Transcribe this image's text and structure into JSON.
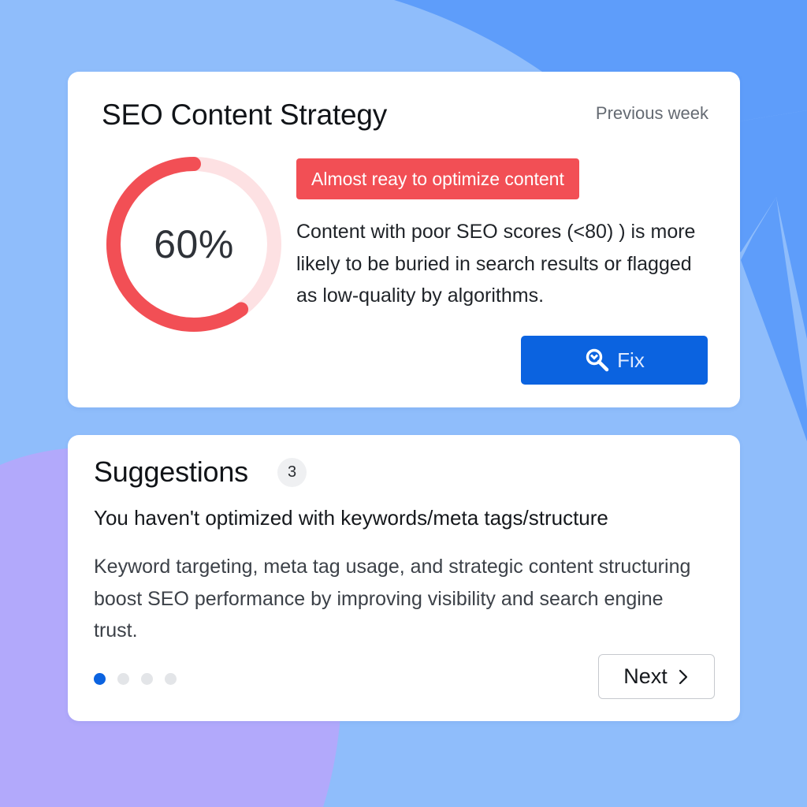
{
  "seo_card": {
    "title": "SEO Content Strategy",
    "period": "Previous week",
    "progress": {
      "value": 0.6,
      "label": "60%",
      "color": "#f24f55",
      "track_color": "#fde1e3"
    },
    "badge": "Almost reay to optimize content",
    "description": "Content with poor SEO scores (<80) ) is more likely to be buried in search results or flagged as low-quality by algorithms.",
    "fix_button": {
      "label": "Fix",
      "icon": "wrench-search-icon"
    }
  },
  "suggestions": {
    "title": "Suggestions",
    "count": "3",
    "heading": "You haven't optimized with keywords/meta tags/structure",
    "body": "Keyword targeting, meta tag usage, and strategic content structuring boost SEO performance by improving visibility and search engine trust.",
    "pagination": {
      "total": 4,
      "active": 0
    },
    "next_button": {
      "label": "Next",
      "icon": "chevron-right-icon"
    }
  },
  "colors": {
    "accent": "#0b63e0",
    "danger": "#f24f55",
    "background": "#8fbdfb"
  }
}
